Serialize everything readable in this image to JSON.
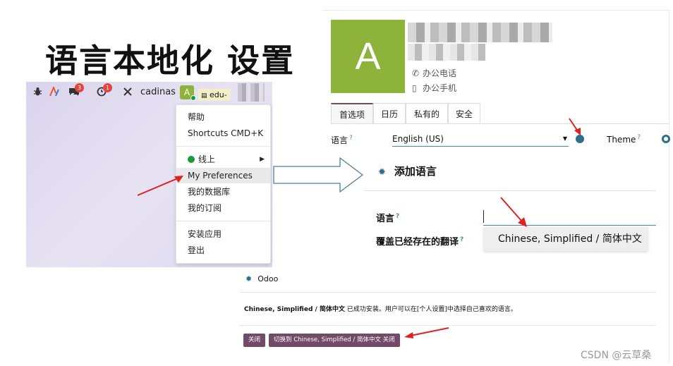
{
  "title": "语言本地化 设置",
  "navbar": {
    "chat_badge": "3",
    "activity_badge": "1",
    "username": "cadinas",
    "avatar_letter": "A",
    "db_name": "edu-"
  },
  "user_menu": {
    "items": {
      "help": "帮助",
      "shortcuts": "Shortcuts CMD+K",
      "online": "线上",
      "preferences": "My Preferences",
      "databases": "我的数据库",
      "subscription": "我的订阅",
      "install_app": "安装应用",
      "logout": "登出"
    }
  },
  "profile": {
    "avatar_letter": "A",
    "office_phone": "办公电话",
    "mobile_phone": "办公手机"
  },
  "tabs": [
    "首选项",
    "日历",
    "私有的",
    "安全"
  ],
  "preferences": {
    "language_label": "语言",
    "language_value": "English (US)",
    "theme_label": "Theme",
    "help_mark": "?"
  },
  "add_language_dialog": {
    "title": "添加语言",
    "language_label": "语言",
    "overwrite_label": "覆盖已经存在的翻译",
    "option": "Chinese, Simplified / 简体中文"
  },
  "notification": {
    "header": "Odoo",
    "language_name": "Chinese, Simplified / 简体中文",
    "message": " 已成功安装。用户可以在[个人设置]中选择自己喜欢的语言。",
    "close_button": "关闭",
    "switch_button": "切换到 Chinese, Simplified / 简体中文 关闭"
  },
  "watermark": "CSDN @云草桑",
  "colors": {
    "odoo_purple": "#714b67",
    "avatar_green": "#8db33b",
    "arrow_red": "#e02020",
    "teal": "#2c6f89"
  },
  "icons": [
    "bug-icon",
    "activity-icon",
    "chat-icon",
    "clock-icon",
    "tools-icon",
    "phone-icon",
    "mobile-icon",
    "globe-icon"
  ]
}
